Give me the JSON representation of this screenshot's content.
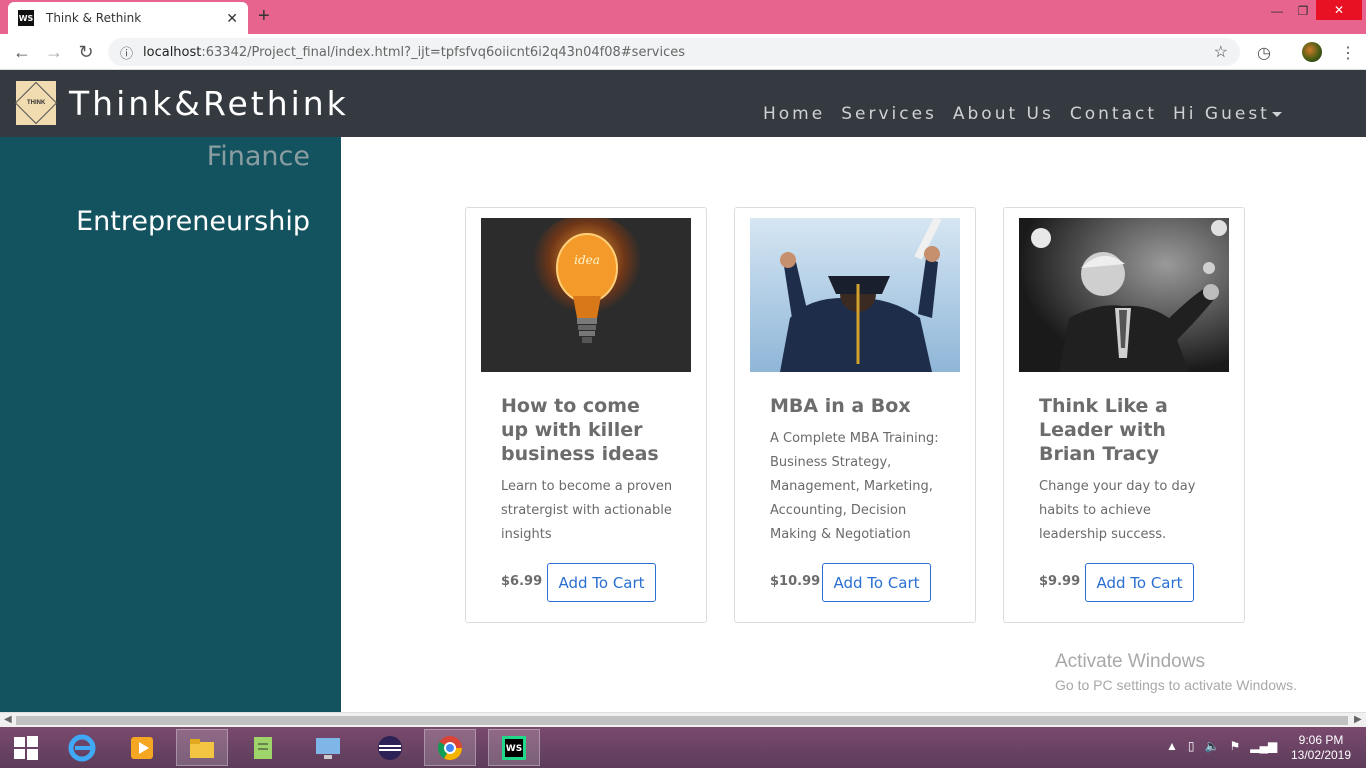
{
  "browser": {
    "tab_title": "Think & Rethink",
    "tab_favicon": "WS",
    "url_host": "localhost",
    "url_rest": ":63342/Project_final/index.html?_ijt=tpfsfvq6oiicnt6i2q43n04f08#services"
  },
  "site": {
    "logo_text": "THINK",
    "brand": "Think&Rethink",
    "nav": {
      "home": "Home",
      "services": "Services",
      "about": "About Us",
      "contact": "Contact",
      "user": "Hi Guest"
    }
  },
  "sidebar": {
    "items": [
      "Finance",
      "Entrepreneurship"
    ]
  },
  "cards": [
    {
      "title": "How to come up with killer business ideas",
      "description": "Learn to become a proven stratergist with actionable insights",
      "price": "$6.99",
      "button": "Add To Cart"
    },
    {
      "title": "MBA in a Box",
      "description": "A Complete MBA Training: Business Strategy, Management, Marketing, Accounting, Decision Making & Negotiation",
      "price": "$10.99",
      "button": "Add To Cart"
    },
    {
      "title": "Think Like a Leader with Brian Tracy",
      "description": "Change your day to day habits to achieve leadership success.",
      "price": "$9.99",
      "button": "Add To Cart"
    }
  ],
  "watermark": {
    "title": "Activate Windows",
    "subtitle": "Go to PC settings to activate Windows."
  },
  "taskbar": {
    "time": "9:06 PM",
    "date": "13/02/2019"
  },
  "colors": {
    "tab_bar": "#e7648e",
    "navbar": "#343a40",
    "sidebar": "#13525f",
    "button_accent": "#2a6fd1"
  }
}
